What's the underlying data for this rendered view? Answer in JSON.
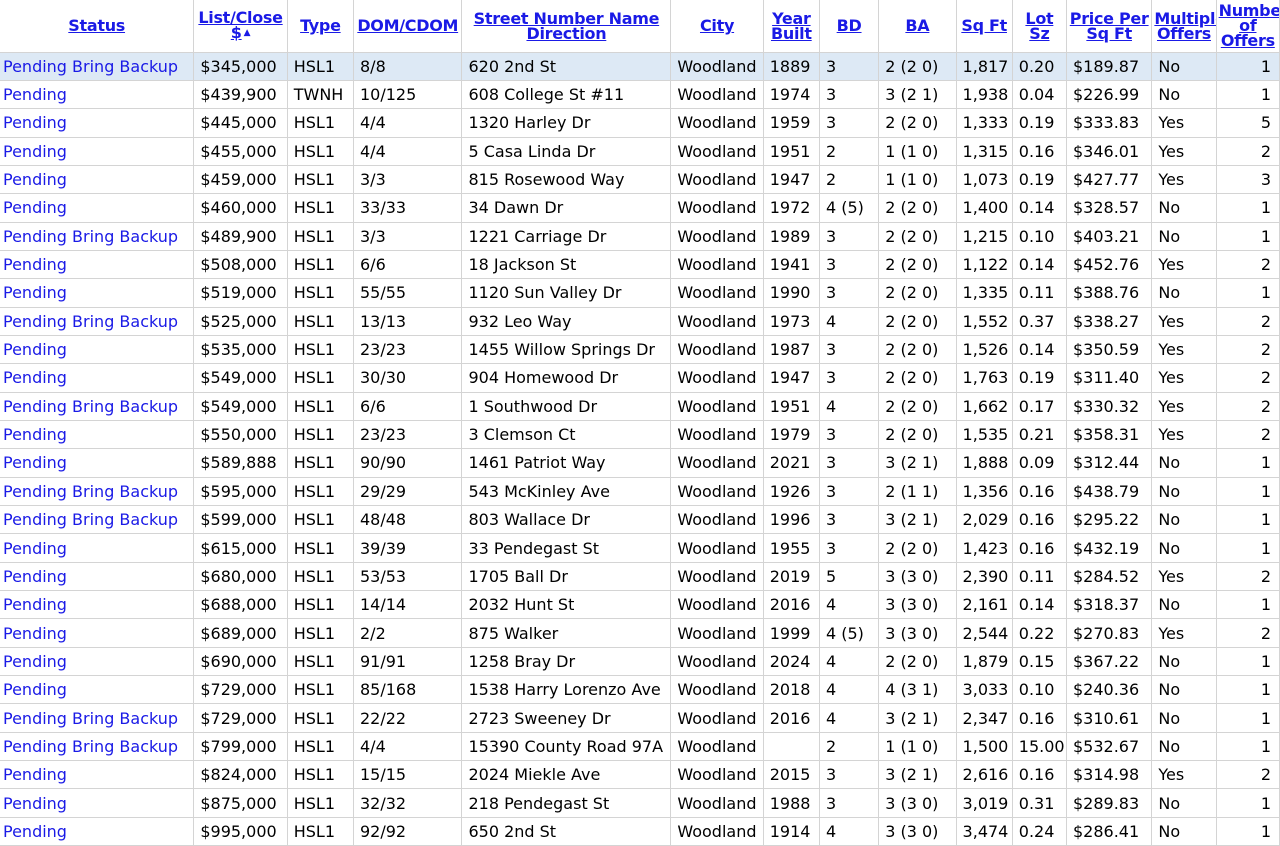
{
  "columns": [
    {
      "key": "status",
      "label": "Status"
    },
    {
      "key": "price",
      "label": "List/Close $"
    },
    {
      "key": "type",
      "label": "Type"
    },
    {
      "key": "dom",
      "label": "DOM/CDOM"
    },
    {
      "key": "street",
      "label": "Street Number Name Direction"
    },
    {
      "key": "city",
      "label": "City"
    },
    {
      "key": "year",
      "label": "Year Built"
    },
    {
      "key": "bd",
      "label": "BD"
    },
    {
      "key": "ba",
      "label": "BA"
    },
    {
      "key": "sqft",
      "label": "Sq Ft"
    },
    {
      "key": "lot",
      "label": "Lot Sz"
    },
    {
      "key": "ppsf",
      "label": "Price Per Sq Ft"
    },
    {
      "key": "multi",
      "label": "Multiple Offers"
    },
    {
      "key": "offers",
      "label": "Number of Offers"
    }
  ],
  "sort": {
    "column": "price",
    "indicator_icon": "sort-ascending-icon",
    "glyph": "▲"
  },
  "selected_row_color": "#dde9f5",
  "link_color": "#1a1ae6",
  "rows": [
    {
      "status": "Pending Bring Backup",
      "price": "$345,000",
      "type": "HSL1",
      "dom": "8/8",
      "street": "620 2nd St",
      "city": "Woodland",
      "year": "1889",
      "bd": "3",
      "ba": "2 (2 0)",
      "sqft": "1,817",
      "lot": "0.20",
      "ppsf": "$189.87",
      "multi": "No",
      "offers": "1"
    },
    {
      "status": "Pending",
      "price": "$439,900",
      "type": "TWNH",
      "dom": "10/125",
      "street": "608 College St #11",
      "city": "Woodland",
      "year": "1974",
      "bd": "3",
      "ba": "3 (2 1)",
      "sqft": "1,938",
      "lot": "0.04",
      "ppsf": "$226.99",
      "multi": "No",
      "offers": "1"
    },
    {
      "status": "Pending",
      "price": "$445,000",
      "type": "HSL1",
      "dom": "4/4",
      "street": "1320 Harley Dr",
      "city": "Woodland",
      "year": "1959",
      "bd": "3",
      "ba": "2 (2 0)",
      "sqft": "1,333",
      "lot": "0.19",
      "ppsf": "$333.83",
      "multi": "Yes",
      "offers": "5"
    },
    {
      "status": "Pending",
      "price": "$455,000",
      "type": "HSL1",
      "dom": "4/4",
      "street": "5 Casa Linda Dr",
      "city": "Woodland",
      "year": "1951",
      "bd": "2",
      "ba": "1 (1 0)",
      "sqft": "1,315",
      "lot": "0.16",
      "ppsf": "$346.01",
      "multi": "Yes",
      "offers": "2"
    },
    {
      "status": "Pending",
      "price": "$459,000",
      "type": "HSL1",
      "dom": "3/3",
      "street": "815 Rosewood Way",
      "city": "Woodland",
      "year": "1947",
      "bd": "2",
      "ba": "1 (1 0)",
      "sqft": "1,073",
      "lot": "0.19",
      "ppsf": "$427.77",
      "multi": "Yes",
      "offers": "3"
    },
    {
      "status": "Pending",
      "price": "$460,000",
      "type": "HSL1",
      "dom": "33/33",
      "street": "34 Dawn Dr",
      "city": "Woodland",
      "year": "1972",
      "bd": "4 (5)",
      "ba": "2 (2 0)",
      "sqft": "1,400",
      "lot": "0.14",
      "ppsf": "$328.57",
      "multi": "No",
      "offers": "1"
    },
    {
      "status": "Pending Bring Backup",
      "price": "$489,900",
      "type": "HSL1",
      "dom": "3/3",
      "street": "1221 Carriage Dr",
      "city": "Woodland",
      "year": "1989",
      "bd": "3",
      "ba": "2 (2 0)",
      "sqft": "1,215",
      "lot": "0.10",
      "ppsf": "$403.21",
      "multi": "No",
      "offers": "1"
    },
    {
      "status": "Pending",
      "price": "$508,000",
      "type": "HSL1",
      "dom": "6/6",
      "street": "18 Jackson St",
      "city": "Woodland",
      "year": "1941",
      "bd": "3",
      "ba": "2 (2 0)",
      "sqft": "1,122",
      "lot": "0.14",
      "ppsf": "$452.76",
      "multi": "Yes",
      "offers": "2"
    },
    {
      "status": "Pending",
      "price": "$519,000",
      "type": "HSL1",
      "dom": "55/55",
      "street": "1120 Sun Valley Dr",
      "city": "Woodland",
      "year": "1990",
      "bd": "3",
      "ba": "2 (2 0)",
      "sqft": "1,335",
      "lot": "0.11",
      "ppsf": "$388.76",
      "multi": "No",
      "offers": "1"
    },
    {
      "status": "Pending Bring Backup",
      "price": "$525,000",
      "type": "HSL1",
      "dom": "13/13",
      "street": "932 Leo Way",
      "city": "Woodland",
      "year": "1973",
      "bd": "4",
      "ba": "2 (2 0)",
      "sqft": "1,552",
      "lot": "0.37",
      "ppsf": "$338.27",
      "multi": "Yes",
      "offers": "2"
    },
    {
      "status": "Pending",
      "price": "$535,000",
      "type": "HSL1",
      "dom": "23/23",
      "street": "1455 Willow Springs Dr",
      "city": "Woodland",
      "year": "1987",
      "bd": "3",
      "ba": "2 (2 0)",
      "sqft": "1,526",
      "lot": "0.14",
      "ppsf": "$350.59",
      "multi": "Yes",
      "offers": "2"
    },
    {
      "status": "Pending",
      "price": "$549,000",
      "type": "HSL1",
      "dom": "30/30",
      "street": "904 Homewood Dr",
      "city": "Woodland",
      "year": "1947",
      "bd": "3",
      "ba": "2 (2 0)",
      "sqft": "1,763",
      "lot": "0.19",
      "ppsf": "$311.40",
      "multi": "Yes",
      "offers": "2"
    },
    {
      "status": "Pending Bring Backup",
      "price": "$549,000",
      "type": "HSL1",
      "dom": "6/6",
      "street": "1 Southwood Dr",
      "city": "Woodland",
      "year": "1951",
      "bd": "4",
      "ba": "2 (2 0)",
      "sqft": "1,662",
      "lot": "0.17",
      "ppsf": "$330.32",
      "multi": "Yes",
      "offers": "2"
    },
    {
      "status": "Pending",
      "price": "$550,000",
      "type": "HSL1",
      "dom": "23/23",
      "street": "3 Clemson Ct",
      "city": "Woodland",
      "year": "1979",
      "bd": "3",
      "ba": "2 (2 0)",
      "sqft": "1,535",
      "lot": "0.21",
      "ppsf": "$358.31",
      "multi": "Yes",
      "offers": "2"
    },
    {
      "status": "Pending",
      "price": "$589,888",
      "type": "HSL1",
      "dom": "90/90",
      "street": "1461 Patriot Way",
      "city": "Woodland",
      "year": "2021",
      "bd": "3",
      "ba": "3 (2 1)",
      "sqft": "1,888",
      "lot": "0.09",
      "ppsf": "$312.44",
      "multi": "No",
      "offers": "1"
    },
    {
      "status": "Pending Bring Backup",
      "price": "$595,000",
      "type": "HSL1",
      "dom": "29/29",
      "street": "543 McKinley Ave",
      "city": "Woodland",
      "year": "1926",
      "bd": "3",
      "ba": "2 (1 1)",
      "sqft": "1,356",
      "lot": "0.16",
      "ppsf": "$438.79",
      "multi": "No",
      "offers": "1"
    },
    {
      "status": "Pending Bring Backup",
      "price": "$599,000",
      "type": "HSL1",
      "dom": "48/48",
      "street": "803 Wallace Dr",
      "city": "Woodland",
      "year": "1996",
      "bd": "3",
      "ba": "3 (2 1)",
      "sqft": "2,029",
      "lot": "0.16",
      "ppsf": "$295.22",
      "multi": "No",
      "offers": "1"
    },
    {
      "status": "Pending",
      "price": "$615,000",
      "type": "HSL1",
      "dom": "39/39",
      "street": "33 Pendegast St",
      "city": "Woodland",
      "year": "1955",
      "bd": "3",
      "ba": "2 (2 0)",
      "sqft": "1,423",
      "lot": "0.16",
      "ppsf": "$432.19",
      "multi": "No",
      "offers": "1"
    },
    {
      "status": "Pending",
      "price": "$680,000",
      "type": "HSL1",
      "dom": "53/53",
      "street": "1705 Ball Dr",
      "city": "Woodland",
      "year": "2019",
      "bd": "5",
      "ba": "3 (3 0)",
      "sqft": "2,390",
      "lot": "0.11",
      "ppsf": "$284.52",
      "multi": "Yes",
      "offers": "2"
    },
    {
      "status": "Pending",
      "price": "$688,000",
      "type": "HSL1",
      "dom": "14/14",
      "street": "2032 Hunt St",
      "city": "Woodland",
      "year": "2016",
      "bd": "4",
      "ba": "3 (3 0)",
      "sqft": "2,161",
      "lot": "0.14",
      "ppsf": "$318.37",
      "multi": "No",
      "offers": "1"
    },
    {
      "status": "Pending",
      "price": "$689,000",
      "type": "HSL1",
      "dom": "2/2",
      "street": "875 Walker",
      "city": "Woodland",
      "year": "1999",
      "bd": "4 (5)",
      "ba": "3 (3 0)",
      "sqft": "2,544",
      "lot": "0.22",
      "ppsf": "$270.83",
      "multi": "Yes",
      "offers": "2"
    },
    {
      "status": "Pending",
      "price": "$690,000",
      "type": "HSL1",
      "dom": "91/91",
      "street": "1258 Bray Dr",
      "city": "Woodland",
      "year": "2024",
      "bd": "4",
      "ba": "2 (2 0)",
      "sqft": "1,879",
      "lot": "0.15",
      "ppsf": "$367.22",
      "multi": "No",
      "offers": "1"
    },
    {
      "status": "Pending",
      "price": "$729,000",
      "type": "HSL1",
      "dom": "85/168",
      "street": "1538 Harry Lorenzo Ave",
      "city": "Woodland",
      "year": "2018",
      "bd": "4",
      "ba": "4 (3 1)",
      "sqft": "3,033",
      "lot": "0.10",
      "ppsf": "$240.36",
      "multi": "No",
      "offers": "1"
    },
    {
      "status": "Pending Bring Backup",
      "price": "$729,000",
      "type": "HSL1",
      "dom": "22/22",
      "street": "2723 Sweeney Dr",
      "city": "Woodland",
      "year": "2016",
      "bd": "4",
      "ba": "3 (2 1)",
      "sqft": "2,347",
      "lot": "0.16",
      "ppsf": "$310.61",
      "multi": "No",
      "offers": "1"
    },
    {
      "status": "Pending Bring Backup",
      "price": "$799,000",
      "type": "HSL1",
      "dom": "4/4",
      "street": "15390 County Road 97A",
      "city": "Woodland",
      "year": "",
      "bd": "2",
      "ba": "1 (1 0)",
      "sqft": "1,500",
      "lot": "15.00",
      "ppsf": "$532.67",
      "multi": "No",
      "offers": "1"
    },
    {
      "status": "Pending",
      "price": "$824,000",
      "type": "HSL1",
      "dom": "15/15",
      "street": "2024 Miekle Ave",
      "city": "Woodland",
      "year": "2015",
      "bd": "3",
      "ba": "3 (2 1)",
      "sqft": "2,616",
      "lot": "0.16",
      "ppsf": "$314.98",
      "multi": "Yes",
      "offers": "2"
    },
    {
      "status": "Pending",
      "price": "$875,000",
      "type": "HSL1",
      "dom": "32/32",
      "street": "218 Pendegast St",
      "city": "Woodland",
      "year": "1988",
      "bd": "3",
      "ba": "3 (3 0)",
      "sqft": "3,019",
      "lot": "0.31",
      "ppsf": "$289.83",
      "multi": "No",
      "offers": "1"
    },
    {
      "status": "Pending",
      "price": "$995,000",
      "type": "HSL1",
      "dom": "92/92",
      "street": "650 2nd St",
      "city": "Woodland",
      "year": "1914",
      "bd": "4",
      "ba": "3 (3 0)",
      "sqft": "3,474",
      "lot": "0.24",
      "ppsf": "$286.41",
      "multi": "No",
      "offers": "1"
    }
  ]
}
